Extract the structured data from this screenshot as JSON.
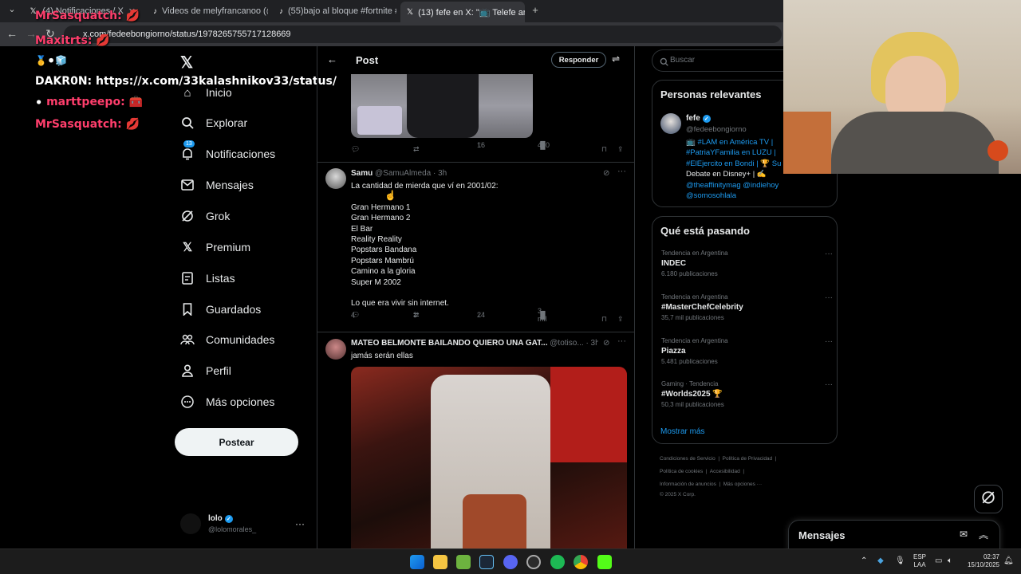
{
  "browser": {
    "tabs": [
      {
        "label": "(4) Notificaciones / X",
        "icon": "x-logo-icon"
      },
      {
        "label": "Videos de melyfrancanoo (@m",
        "icon": "tiktok-icon"
      },
      {
        "label": "(55)bajo al bloque #fortnite #fo",
        "icon": "tiktok-icon"
      },
      {
        "label": "(13) fefe en X: \"📺 Telefe anunc",
        "icon": "x-logo-icon"
      }
    ],
    "url": "x.com/fedeebongiorno/status/1978265755717128669"
  },
  "stream_chat": [
    {
      "user": "MrSasquatch:",
      "msg": "💋"
    },
    {
      "user": "Maxitrts:",
      "msg": "💋"
    },
    {
      "user": "",
      "msg": "🥇⚫🧊"
    },
    {
      "user": "DAKR0N:",
      "msg": "https://x.com/33kalashnikov33/status/",
      "plain_user": true
    },
    {
      "user": "marttpeepo:",
      "msg": "🧰",
      "prefix": "⚫"
    },
    {
      "user": "MrSasquatch:",
      "msg": "💋"
    }
  ],
  "nav": {
    "items": [
      {
        "label": "Inicio",
        "icon": "home-icon"
      },
      {
        "label": "Explorar",
        "icon": "search-icon"
      },
      {
        "label": "Notificaciones",
        "icon": "bell-icon",
        "badge": "13"
      },
      {
        "label": "Mensajes",
        "icon": "mail-icon"
      },
      {
        "label": "Grok",
        "icon": "grok-icon"
      },
      {
        "label": "Premium",
        "icon": "x-logo-icon"
      },
      {
        "label": "Listas",
        "icon": "list-icon"
      },
      {
        "label": "Guardados",
        "icon": "bookmark-icon"
      },
      {
        "label": "Comunidades",
        "icon": "communities-icon"
      },
      {
        "label": "Perfil",
        "icon": "person-icon"
      },
      {
        "label": "Más opciones",
        "icon": "more-circle-icon"
      }
    ],
    "post_button": "Postear",
    "account": {
      "name": "lolo",
      "handle": "@lolomorales_"
    }
  },
  "center": {
    "header_title": "Post",
    "reply_button": "Responder",
    "tweet0": {
      "replies": "",
      "retweets": "",
      "likes": "16",
      "views": "490"
    },
    "tweet1": {
      "author": "Samu",
      "handle": "@SamuAlmeda",
      "time": "· 3h",
      "text": "La cantidad de mierda que ví en 2001/02:\n\nGran Hermano 1\nGran Hermano 2\nEl Bar\nReality Reality\nPopstars Bandana\nPopstars Mambrú\nCamino a la gloria\nSuper M 2002\n\nLo que era vivir sin internet.",
      "replies": "4",
      "retweets": "3",
      "likes": "24",
      "views": "3 mil"
    },
    "tweet2": {
      "author": "MATEO BELMONTE BAILANDO QUIERO UNA GAT...",
      "handle": "@totiso...",
      "time": "· 3h",
      "text": "jamás serán ellas"
    }
  },
  "right": {
    "search_placeholder": "Buscar",
    "relevant_title": "Personas relevantes",
    "person": {
      "name": "fefe",
      "handle": "@fedeebongiorno",
      "bio_l1": "📺 #LAM en América TV |",
      "bio_l2": "#PatriaYFamilia en LUZU |",
      "bio_l3": "#ElEjercito en Bondi | 🏆 Su",
      "bio_l4": "Debate en Disney+ | ✍️",
      "bio_l5": "@theaffinitymag @indiehoy",
      "bio_l6": "@somosohlala"
    },
    "trending_title": "Qué está pasando",
    "trends": [
      {
        "category": "Tendencia en Argentina",
        "name": "INDEC",
        "count": "6.180 publicaciones"
      },
      {
        "category": "Tendencia en Argentina",
        "name": "#MasterChefCelebrity",
        "count": "35,7 mil publicaciones"
      },
      {
        "category": "Tendencia en Argentina",
        "name": "Piazza",
        "count": "5.481 publicaciones"
      },
      {
        "category": "Gaming · Tendencia",
        "name": "#Worlds2025 🏆",
        "count": "50,3 mil publicaciones"
      }
    ],
    "show_more": "Mostrar más",
    "footer": {
      "l1a": "Condiciones de Servicio",
      "l1b": "Política de Privacidad",
      "l2a": "Política de cookies",
      "l2b": "Accesibilidad",
      "l3a": "Información de anuncios",
      "l3b": "Más opciones ···",
      "l4": "© 2025 X Corp."
    },
    "messages_title": "Mensajes"
  },
  "taskbar": {
    "lang": "ESP",
    "lang2": "LAA",
    "time": "02:37",
    "date": "15/10/2025"
  },
  "colors": {
    "accent": "#1d9bf0",
    "chat_user": "#ff3e6c"
  }
}
